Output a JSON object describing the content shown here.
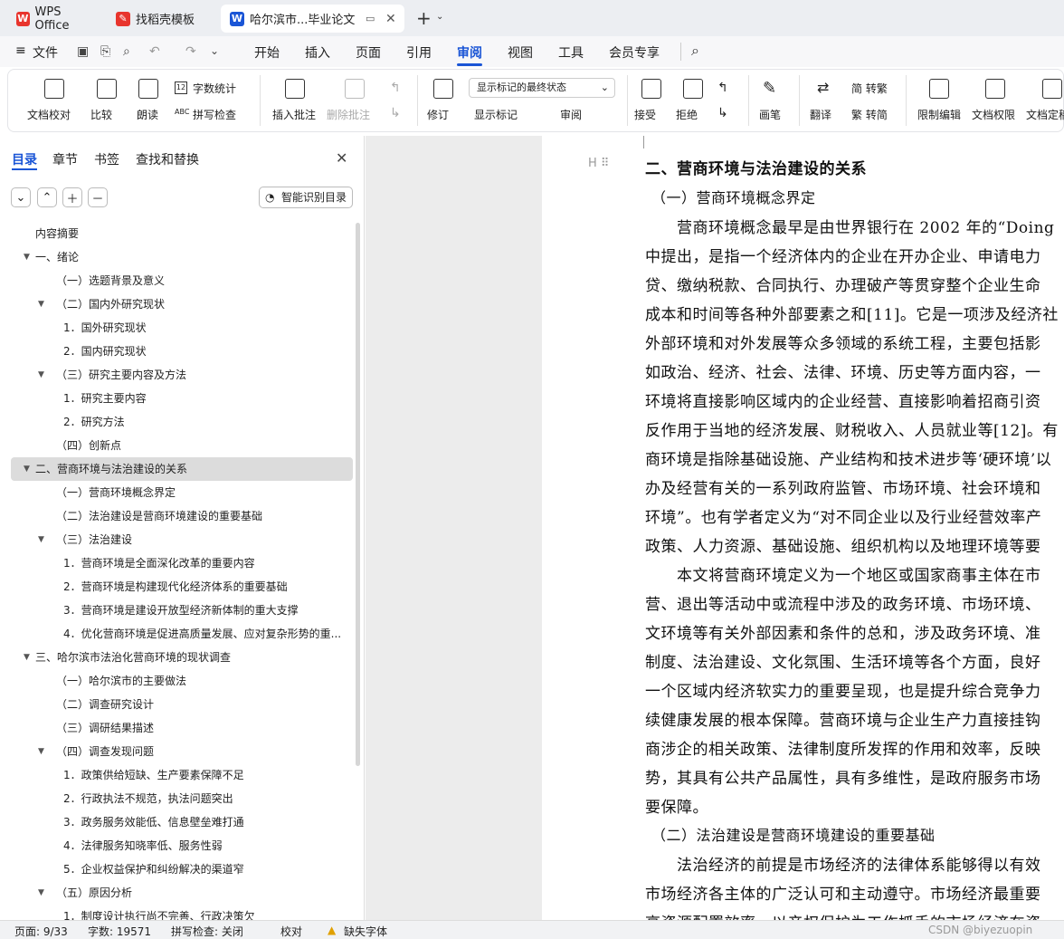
{
  "tabs": [
    {
      "label": "WPS Office"
    },
    {
      "label": "找稻壳模板"
    },
    {
      "label": "哈尔滨市...毕业论文"
    }
  ],
  "menu": {
    "file": "文件",
    "items": [
      "开始",
      "插入",
      "页面",
      "引用",
      "审阅",
      "视图",
      "工具",
      "会员专享"
    ],
    "active": "审阅"
  },
  "ribbon": {
    "doc_check": "文档校对",
    "compare": "比较",
    "read": "朗读",
    "word_count": "字数统计",
    "spell_check": "拼写检查",
    "insert_comment": "插入批注",
    "delete_comment": "删除批注",
    "revise": "修订",
    "markup_select": "显示标记的最终状态",
    "show_markup": "显示标记",
    "review_pane": "审阅",
    "accept": "接受",
    "reject": "拒绝",
    "pen": "画笔",
    "translate": "翻译",
    "to_trad": "简 转繁",
    "to_simp": "繁 转简",
    "restrict_edit": "限制编辑",
    "doc_permission": "文档权限",
    "doc_final": "文档定稿"
  },
  "panel": {
    "tabs": [
      "目录",
      "章节",
      "书签",
      "查找和替换"
    ],
    "smart_toc": "智能识别目录",
    "toc": [
      {
        "text": "内容摘要",
        "level": 0,
        "arrow": ""
      },
      {
        "text": "一、绪论",
        "level": 0,
        "arrow": "▼"
      },
      {
        "text": "（一）选题背景及意义",
        "level": 1,
        "arrow": ""
      },
      {
        "text": "（二）国内外研究现状",
        "level": 1,
        "arrow": "▼"
      },
      {
        "text": "1．国外研究现状",
        "level": 2,
        "arrow": ""
      },
      {
        "text": "2．国内研究现状",
        "level": 2,
        "arrow": ""
      },
      {
        "text": "（三）研究主要内容及方法",
        "level": 1,
        "arrow": "▼"
      },
      {
        "text": "1．研究主要内容",
        "level": 2,
        "arrow": ""
      },
      {
        "text": "2．研究方法",
        "level": 2,
        "arrow": ""
      },
      {
        "text": "（四）创新点",
        "level": 1,
        "arrow": ""
      },
      {
        "text": "二、营商环境与法治建设的关系",
        "level": 0,
        "arrow": "▼"
      },
      {
        "text": "（一）营商环境概念界定",
        "level": 1,
        "arrow": ""
      },
      {
        "text": "（二）法治建设是营商环境建设的重要基础",
        "level": 1,
        "arrow": ""
      },
      {
        "text": "（三）法治建设",
        "level": 1,
        "arrow": "▼"
      },
      {
        "text": "1．营商环境是全面深化改革的重要内容",
        "level": 2,
        "arrow": ""
      },
      {
        "text": "2．营商环境是构建现代化经济体系的重要基础",
        "level": 2,
        "arrow": ""
      },
      {
        "text": "3．营商环境是建设开放型经济新体制的重大支撑",
        "level": 2,
        "arrow": ""
      },
      {
        "text": "4．优化营商环境是促进高质量发展、应对复杂形势的重...",
        "level": 2,
        "arrow": ""
      },
      {
        "text": "三、哈尔滨市法治化营商环境的现状调查",
        "level": 0,
        "arrow": "▼"
      },
      {
        "text": "（一）哈尔滨市的主要做法",
        "level": 1,
        "arrow": ""
      },
      {
        "text": "（二）调查研究设计",
        "level": 1,
        "arrow": ""
      },
      {
        "text": "（三）调研结果描述",
        "level": 1,
        "arrow": ""
      },
      {
        "text": "（四）调查发现问题",
        "level": 1,
        "arrow": "▼"
      },
      {
        "text": "1．政策供给短缺、生产要素保障不足",
        "level": 2,
        "arrow": ""
      },
      {
        "text": "2．行政执法不规范，执法问题突出",
        "level": 2,
        "arrow": ""
      },
      {
        "text": "3．政务服务效能低、信息壁垒难打通",
        "level": 2,
        "arrow": ""
      },
      {
        "text": "4．法律服务知晓率低、服务性弱",
        "level": 2,
        "arrow": ""
      },
      {
        "text": "5．企业权益保护和纠纷解决的渠道窄",
        "level": 2,
        "arrow": ""
      },
      {
        "text": "（五）原因分析",
        "level": 1,
        "arrow": "▼"
      },
      {
        "text": "1．制度设计执行尚不完善、行政决策欠",
        "level": 2,
        "arrow": ""
      }
    ]
  },
  "doc": {
    "lines": [
      "二、营商环境与法治建设的关系",
      "（一）营商环境概念界定",
      "　　营商环境概念最早是由世界银行在 2002 年的“Doing",
      "中提出，是指一个经济体内的企业在开办企业、申请电力",
      "贷、缴纳税款、合同执行、办理破产等贯穿整个企业生命",
      "成本和时间等各种外部要素之和[11]。它是一项涉及经济社",
      "外部环境和对外发展等众多领域的系统工程，主要包括影",
      "如政治、经济、社会、法律、环境、历史等方面内容，一",
      "环境将直接影响区域内的企业经营、直接影响着招商引资",
      "反作用于当地的经济发展、财税收入、人员就业等[12]。有",
      "商环境是指除基础设施、产业结构和技术进步等‘硬环境’以",
      "办及经营有关的一系列政府监管、市场环境、社会环境和",
      "环境”。也有学者定义为“对不同企业以及行业经营效率产",
      "政策、人力资源、基础设施、组织机构以及地理环境等要",
      "　　本文将营商环境定义为一个地区或国家商事主体在市",
      "营、退出等活动中或流程中涉及的政务环境、市场环境、",
      "文环境等有关外部因素和条件的总和，涉及政务环境、准",
      "制度、法治建设、文化氛围、生活环境等各个方面，良好",
      "一个区域内经济软实力的重要呈现，也是提升综合竞争力",
      "续健康发展的根本保障。营商环境与企业生产力直接挂钩",
      "商涉企的相关政策、法律制度所发挥的作用和效率，反映",
      "势，其具有公共产品属性，具有多维性，是政府服务市场",
      "要保障。",
      "（二）法治建设是营商环境建设的重要基础",
      "　　法治经济的前提是市场经济的法律体系能够得以有效",
      "市场经济各主体的广泛认可和主动遵守。市场经济最重要",
      "高资源配置效率，以产权保护为工作抓手的市场经济在资"
    ]
  },
  "status": {
    "page": "页面: 9/33",
    "words": "字数: 19571",
    "spell": "拼写检查: 关闭",
    "proof": "校对",
    "font_warn": "缺失字体",
    "watermark": "CSDN @biyezuopin"
  },
  "colors": {
    "accent": "#1a55d6",
    "wps_red": "#e8342d"
  }
}
